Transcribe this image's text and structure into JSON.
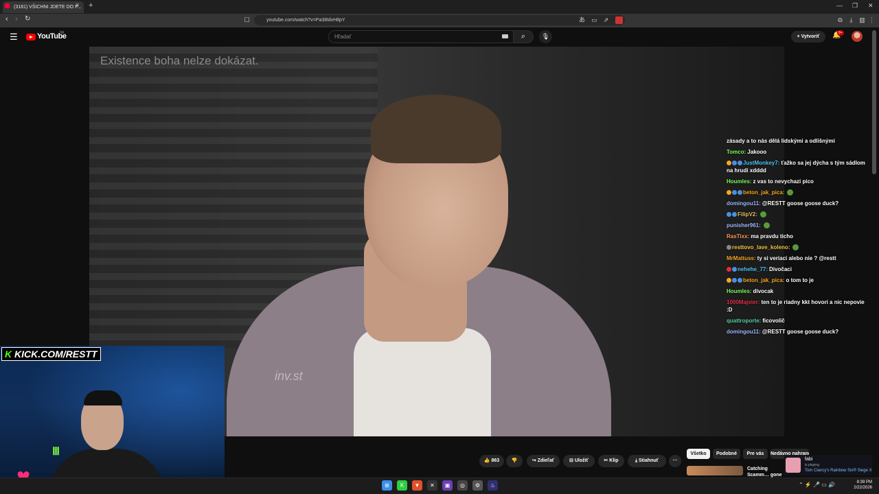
{
  "browser": {
    "tab_title": "(3181) VŠICHNI JDETE DO P...",
    "url": "youtube.com/watch?v=Pa3i8dvH8pY",
    "new_tab": "+",
    "close": "×",
    "window_controls": [
      "—",
      "❐",
      "✕"
    ]
  },
  "youtube": {
    "logo_text": "YouTube",
    "region": "SK",
    "search_placeholder": "Hľadať",
    "create_label": "Vytvoriť",
    "notification_count": "9+"
  },
  "video": {
    "overlay_caption": "Existence boha nelze dokázat.",
    "mic_logo": "inv.st"
  },
  "stream_overlay": {
    "kick_url": "KICK.COM/RESTT"
  },
  "chat": [
    {
      "user": "",
      "user_color": "#ffffff",
      "badges": [],
      "text": "zásady a to nás dělá lidskými a odlišnými"
    },
    {
      "user": "Tomco:",
      "user_color": "#7cff5a",
      "badges": [],
      "text": "Jakooo"
    },
    {
      "user": "JustMonkey7:",
      "user_color": "#4fc3f7",
      "badges": [
        "#f5a623",
        "#4a90e2",
        "#4a90e2"
      ],
      "text": "ťažko sa jej dýcha s tým sádlom na hrudi xdddd"
    },
    {
      "user": "Houmles:",
      "user_color": "#7cff5a",
      "badges": [],
      "text": "z vas to nevychazi pico"
    },
    {
      "user": "beton_jak_pica:",
      "user_color": "#f5a623",
      "badges": [
        "#f5a623",
        "#4a90e2",
        "#4a90e2"
      ],
      "text": "",
      "emote": true
    },
    {
      "user": "domingou11:",
      "user_color": "#a0b8ff",
      "badges": [],
      "text": "@RESTT goose goose duck?"
    },
    {
      "user": "FilipV2:",
      "user_color": "#e0c15a",
      "badges": [
        "#4a90e2",
        "#4a90e2"
      ],
      "text": "",
      "emote": true
    },
    {
      "user": "punisher961:",
      "user_color": "#a0b8ff",
      "badges": [],
      "text": "",
      "emote": true
    },
    {
      "user": "RasTixx:",
      "user_color": "#ff9a5a",
      "badges": [],
      "text": "ma pravdu ticho"
    },
    {
      "user": "resttovo_lave_koleno:",
      "user_color": "#f5c542",
      "badges": [
        "#888888"
      ],
      "text": "",
      "emote": true
    },
    {
      "user": "MrMattuss:",
      "user_color": "#f5a623",
      "badges": [],
      "text": "ty si veriaci alebo nie ? @restt"
    },
    {
      "user": "nehehe_77:",
      "user_color": "#4fc3f7",
      "badges": [
        "#e03030",
        "#4a90e2"
      ],
      "text": "Divočaci"
    },
    {
      "user": "beton_jak_pica:",
      "user_color": "#f5a623",
      "badges": [
        "#f5a623",
        "#4a90e2",
        "#4a90e2"
      ],
      "text": "o tom to je"
    },
    {
      "user": "Houmles:",
      "user_color": "#7cff5a",
      "badges": [],
      "text": "divocak"
    },
    {
      "user": "1000Majster:",
      "user_color": "#e0304a",
      "badges": [],
      "text": "ten to je riadny kkt hovori a nic nepovie :D"
    },
    {
      "user": "quattroporte:",
      "user_color": "#5ad1a0",
      "badges": [],
      "text": "ficovolič"
    },
    {
      "user": "domingou11:",
      "user_color": "#a0b8ff",
      "badges": [],
      "text": "@RESTT goose goose duck?"
    }
  ],
  "actions": {
    "likes": "863",
    "share": "Zdieľať",
    "save": "Uložiť",
    "clip": "Klip",
    "download": "Stiahnuť",
    "more": "···"
  },
  "chips": [
    "Všetko",
    "Podobné",
    "Pre vás",
    "Nedávno nahrané"
  ],
  "side_video": {
    "title": "Catching Scamm… gone WRONG!..."
  },
  "now_playing": {
    "name": "fabi",
    "status": "is playing",
    "game": "Tom Clancy's Rainbow Six® Siege X"
  },
  "taskbar": {
    "time": "8:39 PM",
    "date": "2/22/2026"
  }
}
